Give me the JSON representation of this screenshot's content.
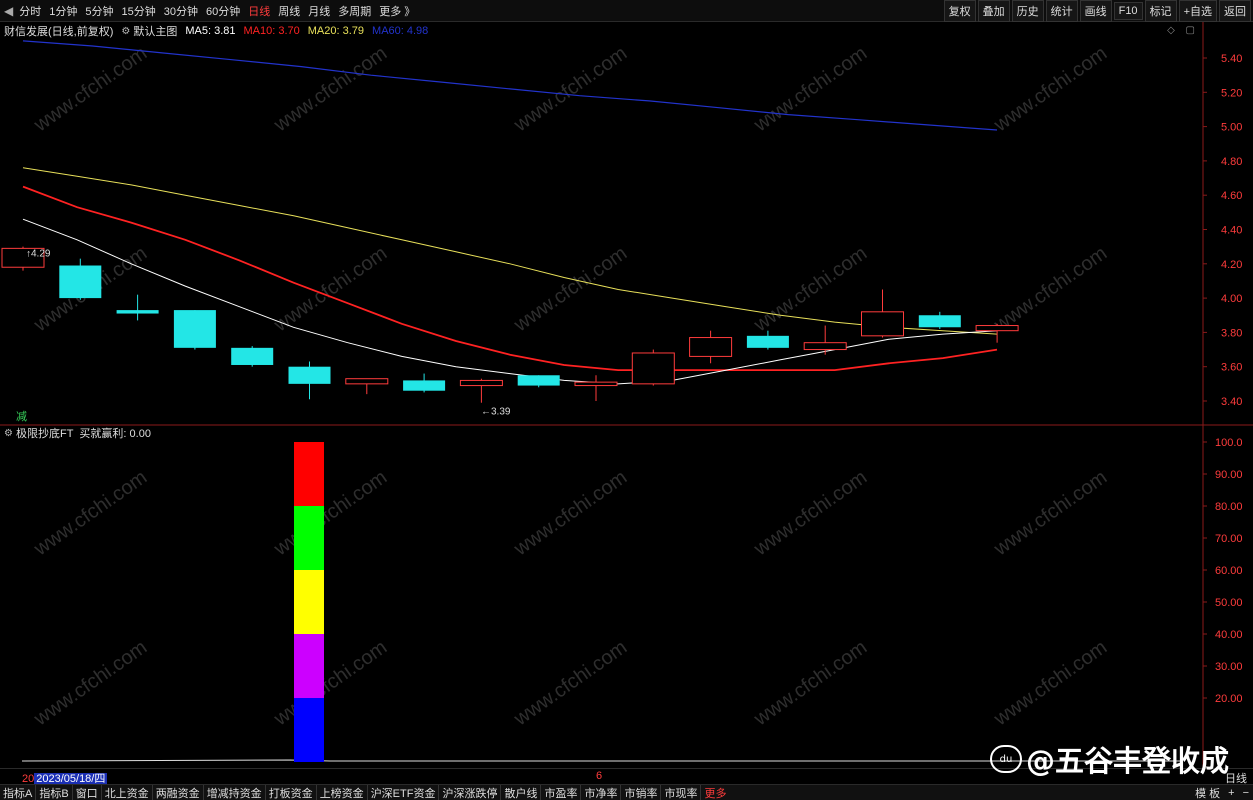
{
  "toolbar": {
    "back_icon": "◀",
    "periods": [
      "分时",
      "1分钟",
      "5分钟",
      "15分钟",
      "30分钟",
      "60分钟",
      "日线",
      "周线",
      "月线",
      "多周期",
      "更多 》"
    ],
    "active_period": "日线",
    "buttons": [
      "复权",
      "叠加",
      "历史",
      "统计",
      "画线",
      "F10",
      "标记",
      "+自选",
      "返回"
    ]
  },
  "main_legend": {
    "title": "财信发展(日线,前复权)",
    "template": "默认主图",
    "ma5": "MA5: 3.81",
    "ma10": "MA10: 3.70",
    "ma20": "MA20: 3.79",
    "ma60": "MA60: 4.98",
    "colors": {
      "ma5": "#ffffff",
      "ma10": "#ff2222",
      "ma20": "#e8e05a",
      "ma60": "#2233cc"
    }
  },
  "top_icons": [
    "◇",
    "▢"
  ],
  "price_axis": {
    "ticks": [
      "5.40",
      "5.20",
      "5.00",
      "4.80",
      "4.60",
      "4.40",
      "4.20",
      "4.00",
      "3.80",
      "3.60",
      "3.40"
    ]
  },
  "annotations": {
    "high": "4.29",
    "low": "←3.39",
    "signal": "减"
  },
  "candles": [
    {
      "o": 4.18,
      "c": 4.29,
      "h": 4.3,
      "l": 4.16
    },
    {
      "o": 4.19,
      "c": 4.0,
      "h": 4.23,
      "l": 3.99
    },
    {
      "o": 3.93,
      "c": 3.91,
      "h": 4.02,
      "l": 3.87
    },
    {
      "o": 3.93,
      "c": 3.71,
      "h": 3.93,
      "l": 3.7
    },
    {
      "o": 3.71,
      "c": 3.61,
      "h": 3.72,
      "l": 3.6
    },
    {
      "o": 3.6,
      "c": 3.5,
      "h": 3.63,
      "l": 3.41
    },
    {
      "o": 3.5,
      "c": 3.53,
      "h": 3.53,
      "l": 3.44
    },
    {
      "o": 3.52,
      "c": 3.46,
      "h": 3.56,
      "l": 3.45
    },
    {
      "o": 3.49,
      "c": 3.52,
      "h": 3.53,
      "l": 3.39
    },
    {
      "o": 3.55,
      "c": 3.49,
      "h": 3.55,
      "l": 3.48
    },
    {
      "o": 3.49,
      "c": 3.51,
      "h": 3.55,
      "l": 3.4
    },
    {
      "o": 3.5,
      "c": 3.68,
      "h": 3.7,
      "l": 3.49
    },
    {
      "o": 3.66,
      "c": 3.77,
      "h": 3.81,
      "l": 3.62
    },
    {
      "o": 3.78,
      "c": 3.71,
      "h": 3.81,
      "l": 3.7
    },
    {
      "o": 3.7,
      "c": 3.74,
      "h": 3.84,
      "l": 3.67
    },
    {
      "o": 3.78,
      "c": 3.92,
      "h": 4.05,
      "l": 3.77
    },
    {
      "o": 3.9,
      "c": 3.83,
      "h": 3.92,
      "l": 3.82
    },
    {
      "o": 3.81,
      "c": 3.84,
      "h": 3.85,
      "l": 3.74
    }
  ],
  "ma_series": {
    "ma5": [
      4.46,
      4.34,
      4.2,
      4.07,
      3.95,
      3.83,
      3.74,
      3.66,
      3.6,
      3.56,
      3.52,
      3.5,
      3.52,
      3.58,
      3.64,
      3.7,
      3.76,
      3.79,
      3.81
    ],
    "ma10": [
      4.65,
      4.53,
      4.44,
      4.34,
      4.22,
      4.09,
      3.97,
      3.85,
      3.75,
      3.67,
      3.61,
      3.58,
      3.58,
      3.58,
      3.58,
      3.58,
      3.62,
      3.65,
      3.7
    ],
    "ma20": [
      4.76,
      4.71,
      4.66,
      4.6,
      4.54,
      4.48,
      4.41,
      4.34,
      4.27,
      4.2,
      4.12,
      4.05,
      4.0,
      3.95,
      3.9,
      3.86,
      3.83,
      3.81,
      3.79
    ],
    "ma60": [
      5.5,
      5.47,
      5.43,
      5.39,
      5.35,
      5.3,
      5.26,
      5.22,
      5.18,
      5.15,
      5.11,
      5.07,
      5.04,
      5.01,
      4.98
    ]
  },
  "indicator": {
    "title": "极限抄底FT",
    "label": "买就赢利: 0.00",
    "axis_ticks": [
      "100.0",
      "90.00",
      "80.00",
      "70.00",
      "60.00",
      "50.00",
      "40.00",
      "30.00",
      "20.00"
    ],
    "bar_value": 100,
    "segment_colors": [
      "#ff0000",
      "#00ff00",
      "#ffff00",
      "#cc00ff",
      "#0000ff"
    ]
  },
  "datebar": {
    "prefix": "20",
    "selected": "2023/05/18/四",
    "tick": "6",
    "period": "日线"
  },
  "bottom_tabs": [
    "指标A",
    "指标B",
    "窗口",
    "北上资金",
    "两融资金",
    "增减持资金",
    "打板资金",
    "上榜资金",
    "沪深ETF资金",
    "沪深涨跌停",
    "散户线",
    "市盈率",
    "市净率",
    "市销率",
    "市现率",
    "更多"
  ],
  "bottom_right": [
    "模 板",
    "+",
    "−"
  ],
  "watermark": {
    "chart_text": "www.cfchi.com",
    "source_text": "@五谷丰登收成",
    "logo_text": "du"
  }
}
